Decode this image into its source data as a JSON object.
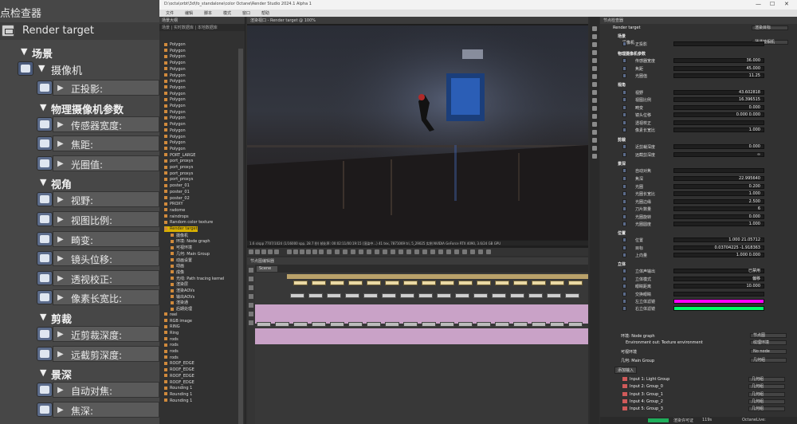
{
  "left_panel": {
    "title": "点检查器",
    "render_target": "Render target",
    "rows": [
      {
        "type": "section",
        "label": "场景",
        "indent": 0
      },
      {
        "type": "camera",
        "label": "摄像机",
        "indent": 1
      },
      {
        "type": "param",
        "label": "正投影:",
        "indent": 2
      },
      {
        "type": "section",
        "label": "物理摄像机参数",
        "indent": 2
      },
      {
        "type": "param",
        "label": "传感器宽度:",
        "indent": 2
      },
      {
        "type": "param",
        "label": "焦距:",
        "indent": 2
      },
      {
        "type": "param",
        "label": "光圈值:",
        "indent": 2
      },
      {
        "type": "section",
        "label": "视角",
        "indent": 2
      },
      {
        "type": "param",
        "label": "视野:",
        "indent": 2
      },
      {
        "type": "param",
        "label": "视图比例:",
        "indent": 2
      },
      {
        "type": "param",
        "label": "畸变:",
        "indent": 2
      },
      {
        "type": "param",
        "label": "镜头位移:",
        "indent": 2
      },
      {
        "type": "param",
        "label": "透视校正:",
        "indent": 2
      },
      {
        "type": "param",
        "label": "像素长宽比:",
        "indent": 2
      },
      {
        "type": "section",
        "label": "剪裁",
        "indent": 2
      },
      {
        "type": "param",
        "label": "近剪裁深度:",
        "indent": 2
      },
      {
        "type": "param",
        "label": "远截剪深度:",
        "indent": 2
      },
      {
        "type": "section",
        "label": "景深",
        "indent": 2
      },
      {
        "type": "param",
        "label": "自动对焦:",
        "indent": 2
      },
      {
        "type": "param",
        "label": "焦深:",
        "indent": 2
      }
    ]
  },
  "app": {
    "window_title": "D:\\octa\\orbt\\3d\\fo_standalone\\color Octane\\Render Studio 2024.1 Alpha 1",
    "menus": [
      "文件",
      "编辑",
      "脚本",
      "模式",
      "窗口",
      "帮助"
    ],
    "outliner": {
      "title": "场景大纲",
      "tabs": "场景  |  实时数据库  |  本地数据库",
      "items": [
        "Polygon",
        "Polygon",
        "Polygon",
        "Polygon",
        "Polygon",
        "Polygon",
        "Polygon",
        "Polygon",
        "Polygon",
        "Polygon",
        "Polygon",
        "Polygon",
        "Polygon",
        "Polygon",
        "Polygon",
        "Polygon",
        "Polygon",
        "Polygon",
        "PORT_LARGE",
        "port_proxys",
        "port_proxys",
        "port_proxys",
        "port_proxys",
        "poster_01",
        "poster_01",
        "poster_02",
        "PROXY",
        "radome",
        "raindrops",
        "Random color texture",
        "Render target",
        "摄像机",
        "环境: Node graph",
        "可视环境",
        "几何: Main Group",
        "动画设置",
        "动画",
        "成像",
        "光线: Path tracing kernel",
        "渲染层",
        "渲染AOVs",
        "输出AOVs",
        "渲染通",
        "后期处理",
        "reel",
        "RGB image",
        "RING",
        "Ring",
        "rods",
        "rods",
        "rods",
        "rods",
        "ROOF_EDGE",
        "ROOF_EDGE",
        "ROOF_EDGE",
        "ROOF_EDGE",
        "Rounding 1",
        "Rounding 1",
        "Rounding 1"
      ],
      "highlight_index": 30
    },
    "viewport": {
      "title": "渲染视口 - Render target @ 100%",
      "status": "1.6 s/spp  7707/1024 (1/16000 spp, 28.7 秒)  帧化率: 00:02:11/00:19:15 (渲染中...)       41 tex, 7871069 tri, 5_29025 实例 NVIDIA GeForce RTX 4090, 3.6/24 GB GPU"
    },
    "graph": {
      "title": "节点图编辑器",
      "tab": "Scene"
    },
    "node_inspector": {
      "title": "节点检查器",
      "top": {
        "label": "Render target",
        "dropdown": "渲染目标"
      },
      "camera": {
        "label": "摄像机",
        "dropdown": "薄透镜相机"
      },
      "rows": [
        {
          "kind": "section",
          "label": "场景"
        },
        {
          "kind": "param",
          "label": "正投影",
          "value": ""
        },
        {
          "kind": "section",
          "label": "物理摄像机参数"
        },
        {
          "kind": "param",
          "label": "传感器宽度",
          "value": "36.000"
        },
        {
          "kind": "param",
          "label": "焦距",
          "value": "45.000"
        },
        {
          "kind": "param",
          "label": "光圈值",
          "value": "11.25"
        },
        {
          "kind": "section",
          "label": "视角"
        },
        {
          "kind": "param",
          "label": "视野",
          "value": "43.602818"
        },
        {
          "kind": "param",
          "label": "视图比例",
          "value": "16.396515"
        },
        {
          "kind": "param",
          "label": "畸变",
          "value": "0.000"
        },
        {
          "kind": "param",
          "label": "镜头位移",
          "value": "0.000      0.000"
        },
        {
          "kind": "param",
          "label": "透视校正",
          "value": ""
        },
        {
          "kind": "param",
          "label": "像素长宽比",
          "value": "1.000"
        },
        {
          "kind": "section",
          "label": "剪裁"
        },
        {
          "kind": "param",
          "label": "近剪裁深度",
          "value": "0.000"
        },
        {
          "kind": "param",
          "label": "远截剪深度",
          "value": "∞"
        },
        {
          "kind": "section",
          "label": "景深"
        },
        {
          "kind": "param",
          "label": "自动对焦",
          "value": ""
        },
        {
          "kind": "param",
          "label": "焦深",
          "value": "22.995640"
        },
        {
          "kind": "param",
          "label": "光圈",
          "value": "0.200"
        },
        {
          "kind": "param",
          "label": "光圈长宽比",
          "value": "1.000"
        },
        {
          "kind": "param",
          "label": "光圈边缘",
          "value": "2.500"
        },
        {
          "kind": "param",
          "label": "刀片数量",
          "value": "6"
        },
        {
          "kind": "param",
          "label": "光圈旋转",
          "value": "0.000"
        },
        {
          "kind": "param",
          "label": "光圈圆度",
          "value": "1.000"
        },
        {
          "kind": "section",
          "label": "位置"
        },
        {
          "kind": "param",
          "label": "位置",
          "value": "1.000    21.05712"
        },
        {
          "kind": "param",
          "label": "目标",
          "value": "0.03704225  -1.918363"
        },
        {
          "kind": "param",
          "label": "上向量",
          "value": "1.000      0.000"
        },
        {
          "kind": "section",
          "label": "立体"
        },
        {
          "kind": "param",
          "label": "立体声输出",
          "value": "已禁用"
        },
        {
          "kind": "param",
          "label": "立体模式",
          "value": "偏移"
        },
        {
          "kind": "param",
          "label": "眼睛距离",
          "value": "10.000"
        },
        {
          "kind": "param",
          "label": "交换眼睛",
          "value": ""
        },
        {
          "kind": "param",
          "label": "左立体滤镜",
          "value": ""
        },
        {
          "kind": "param",
          "label": "右立体滤镜",
          "value": ""
        }
      ],
      "env": {
        "label": "环境: Node graph",
        "dropdown": "节点图"
      },
      "env_sub": "Environment out: Texture environment",
      "env_sub_dd": "纹理环境",
      "visible_env": "可视环境",
      "visible_env_dd": "No node",
      "geo": {
        "label": "几何: Main Group",
        "dropdown": "几何组"
      },
      "add_input": "添加输入",
      "inputs": [
        {
          "label": "Input 1: Light Group",
          "dd": "几何组"
        },
        {
          "label": "Input 2: Group_0",
          "dd": "几何组"
        },
        {
          "label": "Input 3: Group_1",
          "dd": "几何组"
        },
        {
          "label": "Input 4: Group_2",
          "dd": "几何组"
        },
        {
          "label": "Input 5: Group_3",
          "dd": "几何组"
        }
      ],
      "status_left": "渲染许可证",
      "status_value": "119s",
      "status_right": "OctaneLive:"
    },
    "colors": {
      "left_stereo": "#ff00ff",
      "right_stereo": "#00ff66",
      "highlight": "#d8b000",
      "graph_pink": "#c9a2c7"
    }
  }
}
